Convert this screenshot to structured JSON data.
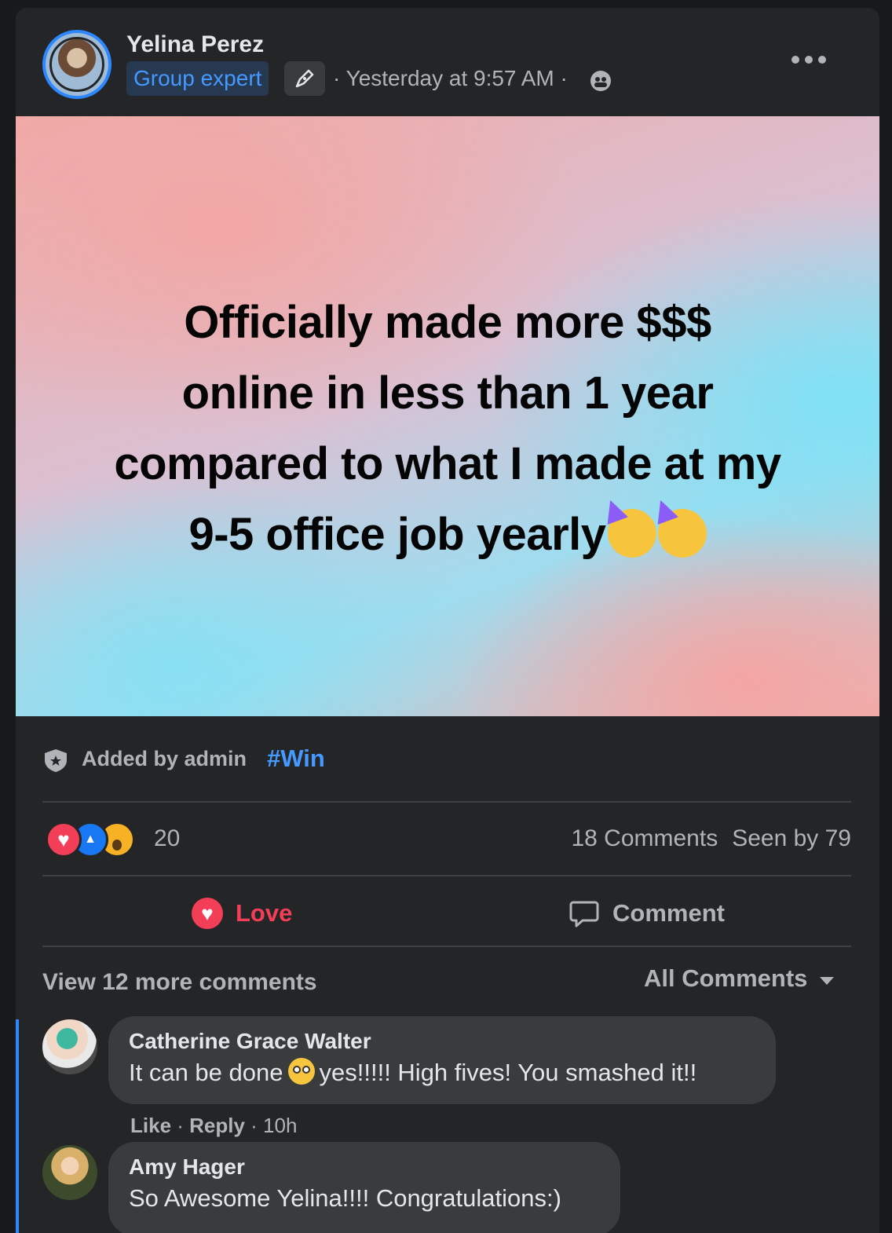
{
  "post": {
    "author": "Yelina Perez",
    "badge": "Group expert",
    "timestamp": "· Yesterday at 9:57 AM ·",
    "banner_line1": "Officially made more $$$",
    "banner_line2": "online in less than 1 year",
    "banner_line3": "compared to what I made at my",
    "banner_line4": "9-5 office job yearly"
  },
  "topic": {
    "added_by": "Added by admin",
    "hashtag": "#Win"
  },
  "stats": {
    "reaction_count": "20",
    "comments": "18 Comments",
    "seen_by": "Seen by 79"
  },
  "actions": {
    "love": "Love",
    "comment": "Comment"
  },
  "comments_section": {
    "view_more": "View 12 more comments",
    "filter": "All Comments",
    "comments": [
      {
        "name": "Catherine Grace Walter",
        "text_before": "It can be done",
        "text_after": "yes!!!!! High fives! You smashed it!!",
        "like": "Like",
        "sep1": " · ",
        "reply": "Reply",
        "time": " · 10h"
      },
      {
        "name": "Amy Hager",
        "text": "So Awesome Yelina!!!! Congratulations:)"
      }
    ]
  },
  "colors": {
    "accent": "#2d88ff",
    "love": "#f33e58",
    "hashtag": "#4599ff"
  }
}
